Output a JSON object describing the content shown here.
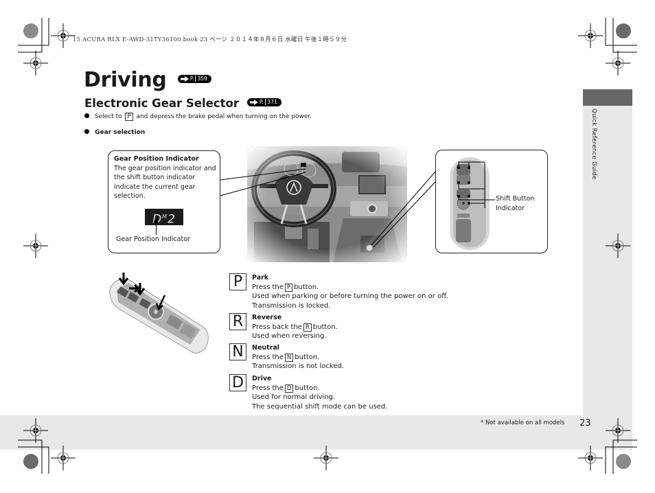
{
  "print_header": "15 ACURA RLX E-AWD-31TY36100.book  23 ページ  ２０１４年８月６日  水曜日  午後１時５９分",
  "side_tab": {
    "label": "Quick Reference Guide"
  },
  "page": {
    "title": "Driving",
    "title_ref": "359",
    "section": "Electronic Gear Selector",
    "section_ref": "371",
    "ref_prefix": "P.",
    "bullets": [
      {
        "pre": "Select to",
        "key": "P",
        "post": "and depress the brake pedal when turning on the power."
      },
      {
        "text": "Gear selection"
      }
    ]
  },
  "callouts": {
    "left": {
      "heading": "Gear Position Indicator",
      "body": "The gear position indicator and the shift button indicator indicate the current gear selection.",
      "display": {
        "gear": "D",
        "mode": "M",
        "step": "2"
      },
      "caption": "Gear Position Indicator"
    },
    "right": {
      "caption_line1": "Shift Button",
      "caption_line2": "Indicator"
    }
  },
  "gears": [
    {
      "key": "P",
      "title": "Park",
      "line1_pre": "Press the",
      "line1_key": "P",
      "line1_post": "button.",
      "lines": [
        "Used when parking or before turning the power on or off.",
        "Transmission is locked."
      ]
    },
    {
      "key": "R",
      "title": "Reverse",
      "line1_pre": "Press back the",
      "line1_key": "R",
      "line1_post": "button.",
      "lines": [
        "Used when reversing."
      ]
    },
    {
      "key": "N",
      "title": "Neutral",
      "line1_pre": "Press the",
      "line1_key": "N",
      "line1_post": "button.",
      "lines": [
        "Transmission is not locked."
      ]
    },
    {
      "key": "D",
      "title": "Drive",
      "line1_pre": "Press the",
      "line1_key": "D",
      "line1_post": "button.",
      "lines": [
        "Used for normal driving.",
        "The sequential shift mode can be used."
      ]
    }
  ],
  "footer": {
    "footnote": "* Not available on all models",
    "page_number": "23"
  },
  "colors": {
    "band": "#e8e8e8",
    "tab": "#666666",
    "ink": "#1a1a1a"
  }
}
